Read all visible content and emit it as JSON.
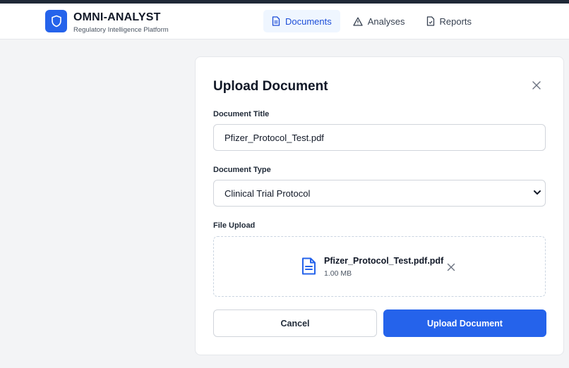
{
  "brand": {
    "title": "OMNI-ANALYST",
    "subtitle": "Regulatory Intelligence Platform",
    "logo_icon": "shield-icon"
  },
  "nav": {
    "items": [
      {
        "label": "Documents",
        "icon": "document-icon",
        "active": true
      },
      {
        "label": "Analyses",
        "icon": "warning-triangle-icon",
        "active": false
      },
      {
        "label": "Reports",
        "icon": "report-icon",
        "active": false
      }
    ]
  },
  "modal": {
    "title": "Upload Document",
    "title_label": "Document Title",
    "title_value": "Pfizer_Protocol_Test.pdf",
    "type_label": "Document Type",
    "type_value": "Clinical Trial Protocol",
    "upload_label": "File Upload",
    "file": {
      "name": "Pfizer_Protocol_Test.pdf.pdf",
      "size": "1.00 MB"
    },
    "cancel_label": "Cancel",
    "submit_label": "Upload Document"
  },
  "colors": {
    "accent": "#2563eb",
    "nav_active_bg": "#eff6ff",
    "page_bg": "#f3f4f6"
  }
}
